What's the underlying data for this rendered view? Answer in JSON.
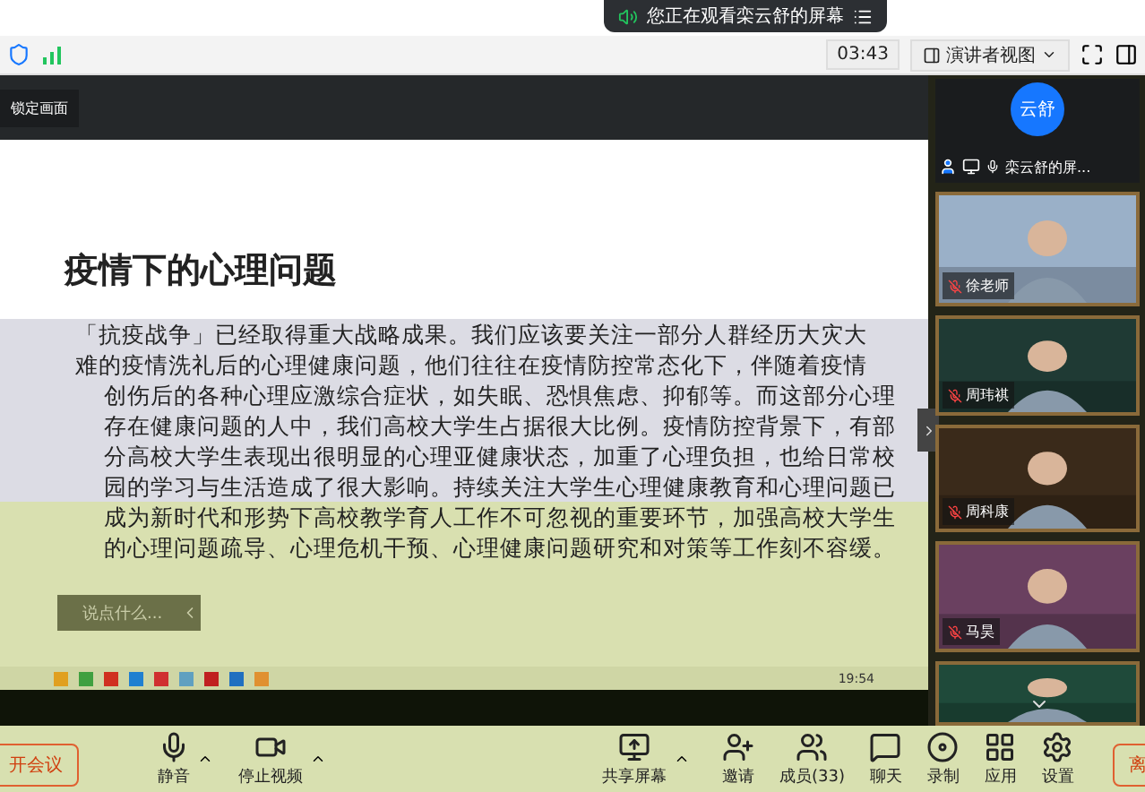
{
  "banner": {
    "text": "您正在观看栾云舒的屏幕"
  },
  "toolbar": {
    "timer": "03:43",
    "view_mode": "演讲者视图"
  },
  "lock_label": "锁定画面",
  "slide": {
    "title": "疫情下的心理问题",
    "lines_top": [
      "「抗疫战争」已经取得重大战略成果。我们应该要关注一部分人群经历大灾大",
      "难的疫情洗礼后的心理健康问题，他们往往在疫情防控常态化下，伴随着疫情"
    ],
    "lines_middle": [
      "创伤后的各种心理应激综合症状，如失眠、恐惧焦虑、抑郁等。而这部分心理",
      "存在健康问题的人中，我们高校大学生占据很大比例。疫情防控背景下，有部",
      "分高校大学生表现出很明显的心理亚健康状态，加重了心理负担，也给日常校",
      "园的学习与生活造成了很大影响。持续关注大学生心理健康教育和心理问题已"
    ],
    "lines_bottom": [
      "成为新时代和形势下高校教学育人工作不可忽视的重要环节，加强高校大学生",
      "的心理问题疏导、心理危机干预、心理健康问题研究和对策等工作刻不容缓。"
    ]
  },
  "chat_input": {
    "placeholder": "说点什么..."
  },
  "taskbar": {
    "time": "19:54"
  },
  "participants": [
    {
      "kind": "avatar",
      "avatar_text": "云舒",
      "name": "栾云舒的屏...",
      "muted": false
    },
    {
      "kind": "video",
      "name": "徐老师",
      "muted": true
    },
    {
      "kind": "video",
      "name": "周玮祺",
      "muted": true
    },
    {
      "kind": "video",
      "name": "周科康",
      "muted": true
    },
    {
      "kind": "video",
      "name": "马昊",
      "muted": true
    },
    {
      "kind": "video"
    }
  ],
  "bottom_bar": {
    "left_button": "开会议",
    "right_button": "离",
    "items": [
      {
        "kind": "mute",
        "label": "静音"
      },
      {
        "kind": "video",
        "label": "停止视频"
      },
      {
        "kind": "share",
        "label": "共享屏幕"
      },
      {
        "kind": "invite",
        "label": "邀请"
      },
      {
        "kind": "members",
        "label": "成员(33)"
      },
      {
        "kind": "chat",
        "label": "聊天"
      },
      {
        "kind": "record",
        "label": "录制"
      },
      {
        "kind": "apps",
        "label": "应用"
      },
      {
        "kind": "settings",
        "label": "设置"
      }
    ]
  }
}
